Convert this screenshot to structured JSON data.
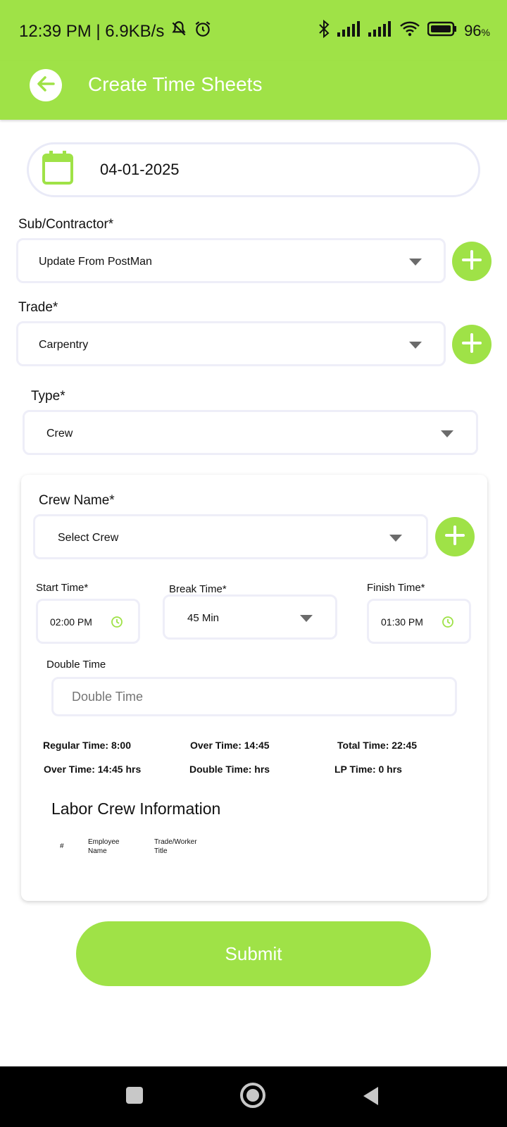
{
  "status_bar": {
    "time_speed": "12:39 PM | 6.9KB/s",
    "battery": "96",
    "battery_unit": "%"
  },
  "header": {
    "title": "Create Time Sheets"
  },
  "date": {
    "value": "04-01-2025"
  },
  "sub_contractor": {
    "label": "Sub/Contractor*",
    "value": "Update From PostMan"
  },
  "trade": {
    "label": "Trade*",
    "value": "Carpentry"
  },
  "type": {
    "label": "Type*",
    "value": "Crew"
  },
  "crew": {
    "name_label": "Crew Name*",
    "name_value": "Select Crew",
    "start_label": "Start Time*",
    "start_value": "02:00 PM",
    "break_label": "Break Time*",
    "break_value": "45 Min",
    "finish_label": "Finish Time*",
    "finish_value": "01:30 PM",
    "double_label": "Double Time",
    "double_placeholder": "Double Time"
  },
  "summary": {
    "regular_time": "Regular Time:  8:00",
    "over_time_1": "Over Time:  14:45",
    "total_time": "Total Time:  22:45",
    "over_time_2": "Over Time:  14:45 hrs",
    "double_time": "Double Time:   hrs",
    "lp_time": "LP Time:  0 hrs"
  },
  "labor_crew": {
    "title": "Labor Crew Information",
    "col_index": "#",
    "col_employee_1": "Employee",
    "col_employee_2": "Name",
    "col_trade_1": "Trade/Worker",
    "col_trade_2": "Title"
  },
  "submit_label": "Submit",
  "colors": {
    "accent": "#9FE247",
    "border": "#EEEEF8",
    "nav": "#000000"
  }
}
